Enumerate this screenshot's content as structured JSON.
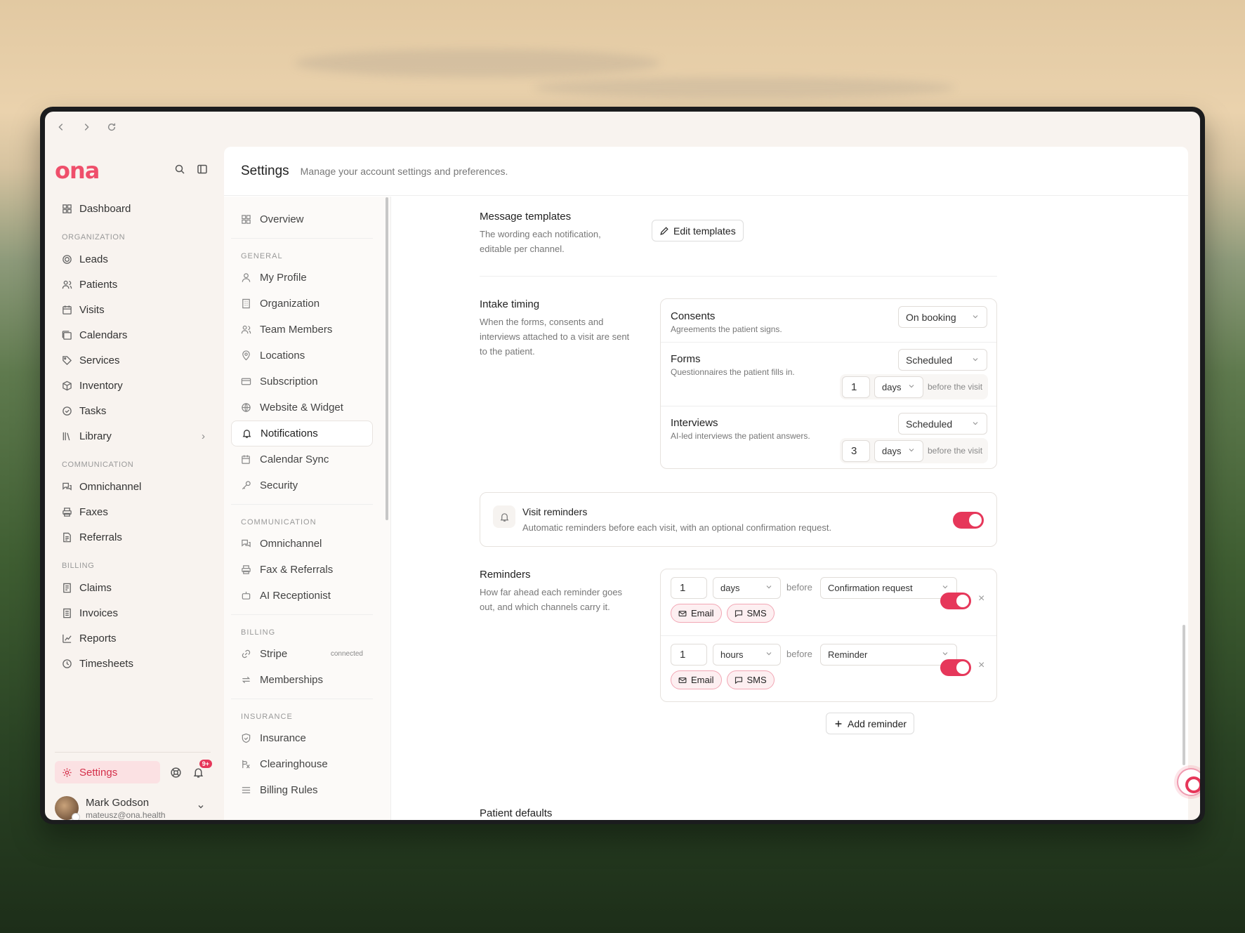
{
  "app": {
    "logo": "ona"
  },
  "sidebar": {
    "dashboard": "Dashboard",
    "org_section": "ORGANIZATION",
    "org_items": [
      "Leads",
      "Patients",
      "Visits",
      "Calendars",
      "Services",
      "Inventory",
      "Tasks",
      "Library"
    ],
    "comm_section": "COMMUNICATION",
    "comm_items": [
      "Omnichannel",
      "Faxes",
      "Referrals"
    ],
    "billing_section": "BILLING",
    "billing_items": [
      "Claims",
      "Invoices",
      "Reports",
      "Timesheets"
    ],
    "settings": "Settings",
    "notif_badge": "9+",
    "user": {
      "name": "Mark Godson",
      "email": "mateusz@ona.health"
    }
  },
  "header": {
    "title": "Settings",
    "subtitle": "Manage your account settings and preferences."
  },
  "settings_nav": {
    "overview": "Overview",
    "general_section": "GENERAL",
    "general_items": [
      "My Profile",
      "Organization",
      "Team Members",
      "Locations",
      "Subscription",
      "Website & Widget",
      "Notifications",
      "Calendar Sync",
      "Security"
    ],
    "comm_section": "COMMUNICATION",
    "comm_items": [
      "Omnichannel",
      "Fax & Referrals",
      "AI Receptionist"
    ],
    "billing_section": "BILLING",
    "stripe": "Stripe",
    "stripe_badge": "connected",
    "memberships": "Memberships",
    "insurance_section": "INSURANCE",
    "insurance_items": [
      "Insurance",
      "Clearinghouse",
      "Billing Rules"
    ]
  },
  "message_templates": {
    "title": "Message templates",
    "desc": "The wording each notification, editable per channel.",
    "button": "Edit templates"
  },
  "intake": {
    "title": "Intake timing",
    "desc": "When the forms, consents and interviews attached to a visit are sent to the patient.",
    "rows": [
      {
        "title": "Consents",
        "desc": "Agreements the patient signs.",
        "select": "On booking"
      },
      {
        "title": "Forms",
        "desc": "Questionnaires the patient fills in.",
        "select": "Scheduled",
        "num": "1",
        "unit": "days",
        "suffix": "before the visit"
      },
      {
        "title": "Interviews",
        "desc": "AI-led interviews the patient answers.",
        "select": "Scheduled",
        "num": "3",
        "unit": "days",
        "suffix": "before the visit"
      }
    ]
  },
  "visit_reminders": {
    "title": "Visit reminders",
    "desc": "Automatic reminders before each visit, with an optional confirmation request.",
    "enabled": true
  },
  "reminders": {
    "title": "Reminders",
    "desc": "How far ahead each reminder goes out, and which channels carry it.",
    "before": "before",
    "items": [
      {
        "num": "1",
        "unit": "days",
        "type": "Confirmation request",
        "channels": [
          "Email",
          "SMS"
        ],
        "enabled": true
      },
      {
        "num": "1",
        "unit": "hours",
        "type": "Reminder",
        "channels": [
          "Email",
          "SMS"
        ],
        "enabled": true
      }
    ],
    "add_button": "Add reminder"
  },
  "patient_defaults": {
    "title": "Patient defaults"
  },
  "colors": {
    "accent": "#e6375a",
    "logo": "#ef4f6b"
  }
}
